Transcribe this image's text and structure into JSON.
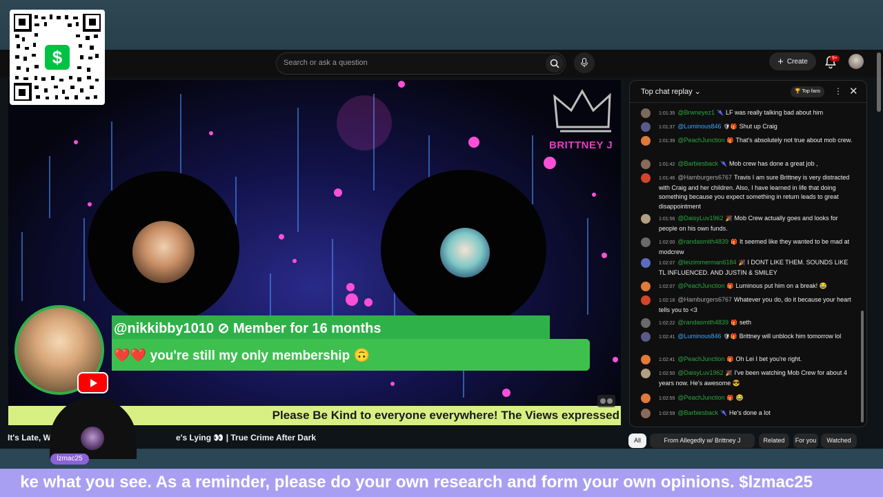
{
  "search": {
    "placeholder": "Search or ask a question"
  },
  "header": {
    "create_label": "Create",
    "notif_badge": "9+"
  },
  "cashapp": {
    "symbol": "$"
  },
  "stream": {
    "brand": "BRITTNEY J",
    "member_name": "@nikkibby1010 ⊘  Member for 16 months",
    "member_message": "❤️❤️ you're still my only membership 🙃",
    "ticker": "Please Be Kind to everyone everywhere! The Views expressed",
    "guest_tag": "lzmac25"
  },
  "video_title": {
    "part1": "It's Late, W",
    "part2": "e's Lying 👀 | True Crime After Dark"
  },
  "bottom_banner": "ke what you see. As a reminder, please do your own research and form your own opinions. $lzmac25",
  "chat": {
    "title": "Top chat replay ⌄",
    "top_fans": "🏆 Top fans",
    "messages": [
      {
        "time": "1:01:35",
        "author": "@Brwneyez1",
        "icon": "🌂",
        "text": "LF was really talking bad about him",
        "color": "green",
        "avatar": "#7a6a5a"
      },
      {
        "time": "1:01:37",
        "author": "@Luminous846",
        "icon": "🛡🎁",
        "text": "Shut up Craig",
        "color": "blue",
        "avatar": "#5a5a8a"
      },
      {
        "time": "1:01:39",
        "author": "@PeachJunction",
        "icon": "🎁",
        "text": "That's absolutely not true about mob crew.",
        "color": "green",
        "avatar": "#e07a3a"
      },
      {
        "time": "1:01:42",
        "author": "@Barbiesback",
        "icon": "🌂",
        "text": "Mob crew has done a great job ,",
        "color": "green",
        "avatar": "#8a6a5a"
      },
      {
        "time": "1:01:46",
        "author": "@Hamburgers6767",
        "icon": "",
        "text": "Travis I am sure Brittney is very distracted with Craig and her children. Also, I have learned in life that doing something because you expect something in return leads to great disappointment",
        "color": "gray",
        "avatar": "#d2452b"
      },
      {
        "time": "1:01:56",
        "author": "@DaisyLuv1962",
        "icon": "🎉",
        "text": "Mob Crew actually goes and looks for people on his own funds.",
        "color": "green",
        "avatar": "#b0a080"
      },
      {
        "time": "1:02:00",
        "author": "@randasmith4839",
        "icon": "🎁",
        "text": "It seemed like they wanted to be mad at modcrew",
        "color": "green",
        "avatar": "#6a6a6a"
      },
      {
        "time": "1:02:07",
        "author": "@leizimmerman6184",
        "icon": "🎉",
        "text": "I DONT LIKE THEM. SOUNDS LIKE TL INFLUENCED. AND JUSTIN & SMILEY",
        "color": "green",
        "avatar": "#5c6bc0"
      },
      {
        "time": "1:02:07",
        "author": "@PeachJunction",
        "icon": "🎁",
        "text": "Luminous put him on a break! 😂",
        "color": "green",
        "avatar": "#e07a3a"
      },
      {
        "time": "1:02:18",
        "author": "@Hamburgers6767",
        "icon": "",
        "text": "Whatever you do, do it because your heart tells you to <3",
        "color": "gray",
        "avatar": "#d2452b"
      },
      {
        "time": "1:02:22",
        "author": "@randasmith4839",
        "icon": "🎁",
        "text": "seth",
        "color": "green",
        "avatar": "#6a6a6a"
      },
      {
        "time": "1:02:41",
        "author": "@Luminous846",
        "icon": "🛡🎁",
        "text": "Brittney will unblock him tomorrow lol",
        "color": "blue",
        "avatar": "#5a5a8a"
      },
      {
        "time": "1:02:41",
        "author": "@PeachJunction",
        "icon": "🎁",
        "text": "Oh Lei I bet you're right.",
        "color": "green",
        "avatar": "#e07a3a"
      },
      {
        "time": "1:02:50",
        "author": "@DaisyLuv1962",
        "icon": "🎉",
        "text": "I've been watching Mob Crew for about 4 years now. He's awesome 😎",
        "color": "green",
        "avatar": "#b0a080"
      },
      {
        "time": "1:02:55",
        "author": "@PeachJunction",
        "icon": "🎁",
        "text": "😂",
        "color": "green",
        "avatar": "#e07a3a"
      },
      {
        "time": "1:02:59",
        "author": "@Barbiesback",
        "icon": "🌂",
        "text": "He's done a lot",
        "color": "green",
        "avatar": "#8a6a5a"
      }
    ]
  },
  "chips": [
    "All",
    "From Allegedly w/ Brittney J",
    "Related",
    "For you",
    "Watched"
  ]
}
